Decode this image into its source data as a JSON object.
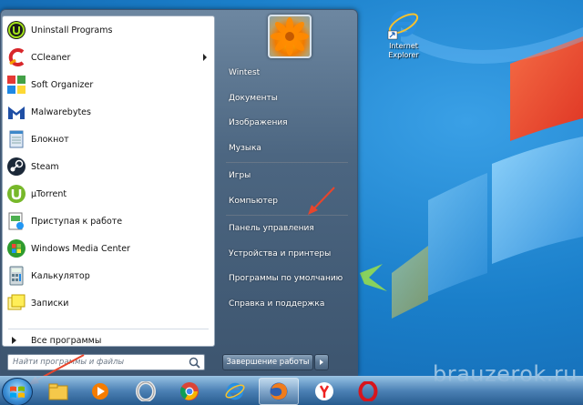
{
  "desktop": {
    "icons": [
      {
        "label": "Internet Explorer",
        "icon": "internet-explorer-icon"
      }
    ],
    "watermark": "brauzerok.ru"
  },
  "start_menu": {
    "programs": [
      {
        "label": "Uninstall Programs",
        "icon": "iobit-uninstaller-icon",
        "has_submenu": false
      },
      {
        "label": "CCleaner",
        "icon": "ccleaner-icon",
        "has_submenu": true
      },
      {
        "label": "Soft Organizer",
        "icon": "soft-organizer-icon",
        "has_submenu": false
      },
      {
        "label": "Malwarebytes",
        "icon": "malwarebytes-icon",
        "has_submenu": false
      },
      {
        "label": "Блокнот",
        "icon": "notepad-icon",
        "has_submenu": false
      },
      {
        "label": "Steam",
        "icon": "steam-icon",
        "has_submenu": false
      },
      {
        "label": "µTorrent",
        "icon": "utorrent-icon",
        "has_submenu": false
      },
      {
        "label": "Приступая к работе",
        "icon": "getting-started-icon",
        "has_submenu": false
      },
      {
        "label": "Windows Media Center",
        "icon": "windows-media-center-icon",
        "has_submenu": false
      },
      {
        "label": "Калькулятор",
        "icon": "calculator-icon",
        "has_submenu": false
      },
      {
        "label": "Записки",
        "icon": "sticky-notes-icon",
        "has_submenu": false
      }
    ],
    "all_programs_label": "Все программы",
    "search_placeholder": "Найти программы и файлы",
    "right_items": [
      {
        "label": "Wintest"
      },
      {
        "label": "Документы"
      },
      {
        "label": "Изображения"
      },
      {
        "label": "Музыка"
      },
      {
        "label": "Игры"
      },
      {
        "label": "Компьютер"
      },
      {
        "label": "Панель управления"
      },
      {
        "label": "Устройства и принтеры"
      },
      {
        "label": "Программы по умолчанию"
      },
      {
        "label": "Справка и поддержка"
      }
    ],
    "shutdown_label": "Завершение работы"
  },
  "taskbar": {
    "pinned": [
      {
        "icon": "file-explorer-icon"
      },
      {
        "icon": "media-player-icon"
      },
      {
        "icon": "opera-icon"
      },
      {
        "icon": "chrome-icon"
      },
      {
        "icon": "internet-explorer-icon"
      },
      {
        "icon": "firefox-icon",
        "active": true
      },
      {
        "icon": "yandex-browser-icon"
      },
      {
        "icon": "opera-red-icon"
      }
    ]
  },
  "colors": {
    "annotation_arrow": "#e8452c",
    "menu_right_pane": "#4c6681",
    "desktop_blue": "#1a7fca"
  }
}
